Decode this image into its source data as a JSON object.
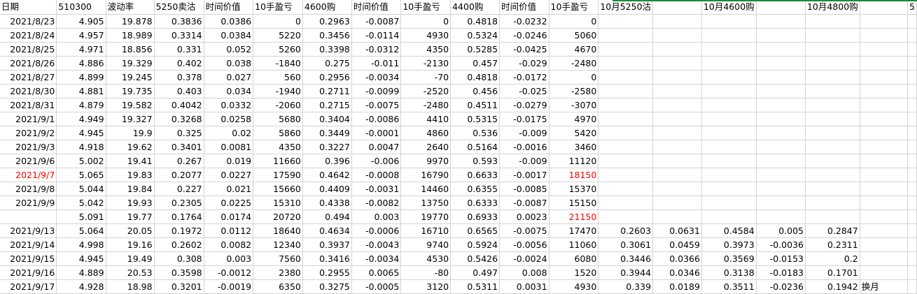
{
  "headers": [
    "日期",
    "510300",
    "波动率",
    "5250卖沽",
    "时间价值",
    "10手盈亏",
    "4600购",
    "时间价值",
    "10手盈亏",
    "4400购",
    "时间价值",
    "10手盈亏",
    "10月5250沽",
    "",
    "10月4600购",
    "",
    "10月4800购",
    "",
    "5"
  ],
  "rows": [
    [
      "2021/8/23",
      "4.905",
      "19.878",
      "0.3836",
      "0.0386",
      "0",
      "0.2963",
      "-0.0087",
      "0",
      "0.4818",
      "-0.0232",
      "0",
      "",
      "",
      "",
      "",
      "",
      "",
      ""
    ],
    [
      "2021/8/24",
      "4.957",
      "18.989",
      "0.3314",
      "0.0384",
      "5220",
      "0.3456",
      "-0.0114",
      "4930",
      "0.5324",
      "-0.0246",
      "5060",
      "",
      "",
      "",
      "",
      "",
      "",
      ""
    ],
    [
      "2021/8/25",
      "4.971",
      "18.856",
      "0.331",
      "0.052",
      "5260",
      "0.3398",
      "-0.0312",
      "4350",
      "0.5285",
      "-0.0425",
      "4670",
      "",
      "",
      "",
      "",
      "",
      "",
      ""
    ],
    [
      "2021/8/26",
      "4.886",
      "19.329",
      "0.402",
      "0.038",
      "-1840",
      "0.275",
      "-0.011",
      "-2130",
      "0.457",
      "-0.029",
      "-2480",
      "",
      "",
      "",
      "",
      "",
      "",
      ""
    ],
    [
      "2021/8/27",
      "4.899",
      "19.245",
      "0.378",
      "0.027",
      "560",
      "0.2956",
      "-0.0034",
      "-70",
      "0.4818",
      "-0.0172",
      "0",
      "",
      "",
      "",
      "",
      "",
      "",
      ""
    ],
    [
      "2021/8/30",
      "4.881",
      "19.735",
      "0.403",
      "0.034",
      "-1940",
      "0.2711",
      "-0.0099",
      "-2520",
      "0.456",
      "-0.025",
      "-2580",
      "",
      "",
      "",
      "",
      "",
      "",
      ""
    ],
    [
      "2021/8/31",
      "4.879",
      "19.582",
      "0.4042",
      "0.0332",
      "-2060",
      "0.2715",
      "-0.0075",
      "-2480",
      "0.4511",
      "-0.0279",
      "-3070",
      "",
      "",
      "",
      "",
      "",
      "",
      ""
    ],
    [
      "2021/9/1",
      "4.949",
      "19.327",
      "0.3268",
      "0.0258",
      "5680",
      "0.3404",
      "-0.0086",
      "4410",
      "0.5315",
      "-0.0175",
      "4970",
      "",
      "",
      "",
      "",
      "",
      "",
      ""
    ],
    [
      "2021/9/2",
      "4.945",
      "19.9",
      "0.325",
      "0.02",
      "5860",
      "0.3449",
      "-0.0001",
      "4860",
      "0.536",
      "-0.009",
      "5420",
      "",
      "",
      "",
      "",
      "",
      "",
      ""
    ],
    [
      "2021/9/3",
      "4.918",
      "19.62",
      "0.3401",
      "0.0081",
      "4350",
      "0.3227",
      "0.0047",
      "2640",
      "0.5164",
      "-0.0016",
      "3460",
      "",
      "",
      "",
      "",
      "",
      "",
      ""
    ],
    [
      "2021/9/6",
      "5.002",
      "19.41",
      "0.267",
      "0.019",
      "11660",
      "0.396",
      "-0.006",
      "9970",
      "0.593",
      "-0.009",
      "11120",
      "",
      "",
      "",
      "",
      "",
      "",
      ""
    ],
    [
      "2021/9/7",
      "5.065",
      "19.83",
      "0.2077",
      "0.0227",
      "17590",
      "0.4642",
      "-0.0008",
      "16790",
      "0.6633",
      "-0.0017",
      "18150",
      "",
      "",
      "",
      "",
      "",
      "",
      ""
    ],
    [
      "2021/9/8",
      "5.044",
      "19.84",
      "0.227",
      "0.021",
      "15660",
      "0.4409",
      "-0.0031",
      "14460",
      "0.6355",
      "-0.0085",
      "15370",
      "",
      "",
      "",
      "",
      "",
      "",
      ""
    ],
    [
      "2021/9/9",
      "5.042",
      "19.93",
      "0.2305",
      "0.0225",
      "15310",
      "0.4338",
      "-0.0082",
      "13750",
      "0.6333",
      "-0.0087",
      "15150",
      "",
      "",
      "",
      "",
      "",
      "",
      ""
    ],
    [
      "",
      "5.091",
      "19.77",
      "0.1764",
      "0.0174",
      "20720",
      "0.494",
      "0.003",
      "19770",
      "0.6933",
      "0.0023",
      "21150",
      "",
      "",
      "",
      "",
      "",
      "",
      ""
    ],
    [
      "2021/9/13",
      "5.064",
      "20.05",
      "0.1972",
      "0.0112",
      "18640",
      "0.4634",
      "-0.0006",
      "16710",
      "0.6565",
      "-0.0075",
      "17470",
      "0.2603",
      "0.0631",
      "0.4584",
      "0.005",
      "0.2847",
      "",
      ""
    ],
    [
      "2021/9/14",
      "4.998",
      "19.16",
      "0.2602",
      "0.0082",
      "12340",
      "0.3937",
      "-0.0043",
      "9740",
      "0.5924",
      "-0.0056",
      "11060",
      "0.3061",
      "0.0459",
      "0.3973",
      "-0.0036",
      "0.2311",
      "",
      ""
    ],
    [
      "2021/9/15",
      "4.945",
      "19.49",
      "0.308",
      "0.003",
      "7560",
      "0.3416",
      "-0.0034",
      "4530",
      "0.5426",
      "-0.0024",
      "6080",
      "0.3446",
      "0.0366",
      "0.3569",
      "-0.0153",
      "0.2",
      "",
      ""
    ],
    [
      "2021/9/16",
      "4.889",
      "20.53",
      "0.3598",
      "-0.0012",
      "2380",
      "0.2955",
      "0.0065",
      "-80",
      "0.497",
      "0.008",
      "1520",
      "0.3944",
      "0.0346",
      "0.3138",
      "-0.0183",
      "0.1701",
      "",
      ""
    ],
    [
      "2021/9/17",
      "4.928",
      "18.98",
      "0.3201",
      "-0.0019",
      "6350",
      "0.3275",
      "-0.0005",
      "3120",
      "0.5311",
      "0.0031",
      "4930",
      "0.339",
      "0.0189",
      "0.3511",
      "-0.0236",
      "0.1942",
      "换月",
      ""
    ]
  ],
  "red_cells": [
    [
      11,
      0
    ],
    [
      11,
      11
    ],
    [
      14,
      11
    ]
  ],
  "colors": {
    "grid": "#d4d4d4",
    "red": "#ff0000",
    "green_line": "#1e8a3a"
  }
}
